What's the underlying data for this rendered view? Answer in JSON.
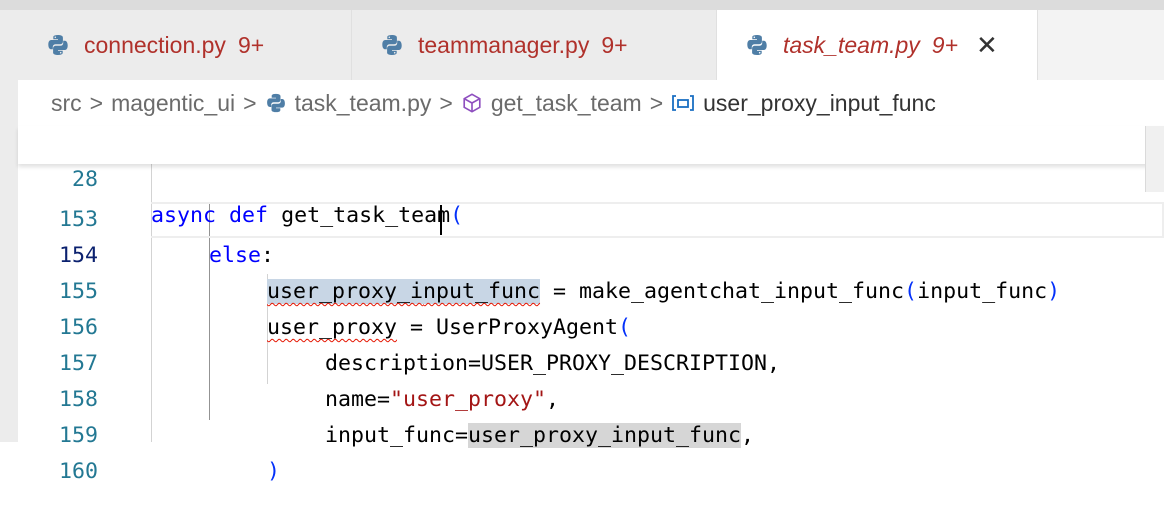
{
  "tabs": [
    {
      "name": "connection.py",
      "badge": "9+"
    },
    {
      "name": "teammanager.py",
      "badge": "9+"
    },
    {
      "name": "task_team.py",
      "badge": "9+"
    }
  ],
  "breadcrumb": {
    "items": [
      "src",
      "magentic_ui",
      "task_team.py",
      "get_task_team",
      "user_proxy_input_func"
    ],
    "separator": ">"
  },
  "editor": {
    "sticky": {
      "line": "28",
      "kw_async": "async",
      "kw_def": "def",
      "name": "get_task_team",
      "paren": "("
    },
    "lines": [
      {
        "n": "153",
        "kw_else": "else",
        "colon": ":"
      },
      {
        "n": "154",
        "var_a": "user_proxy_i",
        "var_b": "nput_func",
        "eq": " = make_agentchat_input_func",
        "open": "(",
        "arg": "input_func",
        "close": ")"
      },
      {
        "n": "155",
        "var": "user_proxy",
        "eq": " = UserProxyAgent",
        "open": "("
      },
      {
        "n": "156",
        "text": "description=USER_PROXY_DESCRIPTION,"
      },
      {
        "n": "157",
        "key": "name=",
        "str": "\"user_proxy\"",
        "comma": ","
      },
      {
        "n": "158",
        "key": "input_func=",
        "ref": "user_proxy_input_func",
        "comma": ","
      },
      {
        "n": "159",
        "close": ")"
      },
      {
        "n": "160"
      }
    ]
  },
  "colors": {
    "tab_text": "#b0312b",
    "line_number": "#237893",
    "keyword": "#0000ff",
    "string": "#a31515",
    "selection": "#c8d6e5"
  }
}
